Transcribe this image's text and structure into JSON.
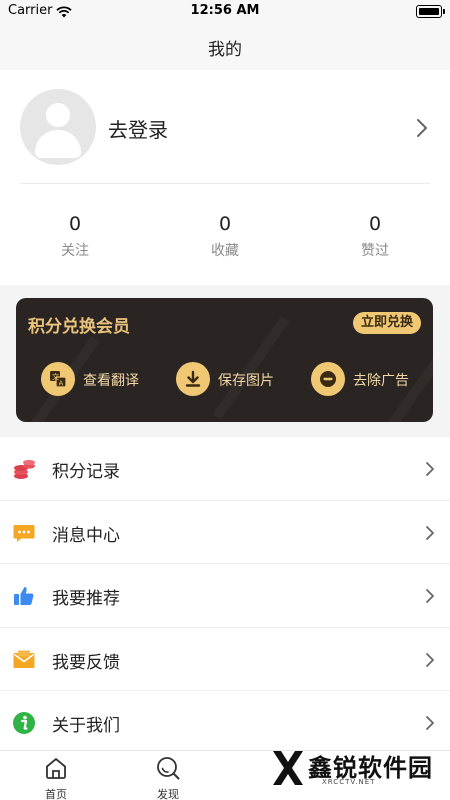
{
  "status_bar": {
    "carrier": "Carrier",
    "time": "12:56 AM"
  },
  "nav": {
    "title": "我的"
  },
  "profile": {
    "login_label": "去登录",
    "stats": [
      {
        "value": "0",
        "label": "关注"
      },
      {
        "value": "0",
        "label": "收藏"
      },
      {
        "value": "0",
        "label": "赞过"
      }
    ]
  },
  "vip": {
    "title": "积分兑换会员",
    "button": "立即兑换",
    "features": [
      {
        "label": "查看翻译",
        "icon": "translate-icon"
      },
      {
        "label": "保存图片",
        "icon": "download-icon"
      },
      {
        "label": "去除广告",
        "icon": "remove-ad-icon"
      }
    ],
    "colors": {
      "card": "#2a2522",
      "accent": "#f0c873"
    }
  },
  "menu": [
    {
      "label": "积分记录",
      "icon": "coins-icon",
      "color": "#e8515c"
    },
    {
      "label": "消息中心",
      "icon": "message-icon",
      "color": "#f5a623"
    },
    {
      "label": "我要推荐",
      "icon": "thumbs-up-icon",
      "color": "#3d8bf0"
    },
    {
      "label": "我要反馈",
      "icon": "feedback-mail-icon",
      "color": "#f5a623"
    },
    {
      "label": "关于我们",
      "icon": "info-icon",
      "color": "#2fb344"
    }
  ],
  "tabs": [
    {
      "label": "首页",
      "icon": "home-icon"
    },
    {
      "label": "发现",
      "icon": "discover-icon"
    }
  ],
  "watermark": {
    "text": "鑫锐软件园",
    "sub": "XRCCTV.NET"
  }
}
